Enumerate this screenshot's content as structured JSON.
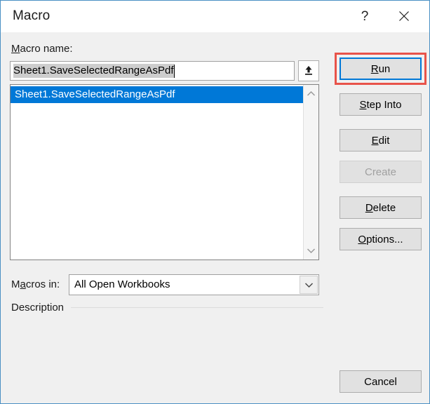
{
  "window": {
    "title": "Macro",
    "help_icon": "question-mark-icon",
    "close_icon": "close-icon"
  },
  "form": {
    "macro_name_label": "Macro name:",
    "macro_name_label_accel": "M",
    "macro_name_value": "Sheet1.SaveSelectedRangeAsPdf",
    "macro_name_placeholder": "",
    "upload_icon": "upload-arrow-icon",
    "macros_in_label": "Macros in:",
    "macros_in_label_accel": "a",
    "macros_in_value": "All Open Workbooks",
    "macros_in_options": [
      "All Open Workbooks"
    ],
    "description_label": "Description",
    "description_value": ""
  },
  "macro_list": {
    "items": [
      {
        "name": "Sheet1.SaveSelectedRangeAsPdf",
        "selected": true
      }
    ],
    "scroll_up_icon": "chevron-up-icon",
    "scroll_down_icon": "chevron-down-icon"
  },
  "buttons": [
    {
      "id": "run",
      "label": "Run",
      "accel": "R",
      "enabled": true,
      "focused": true,
      "annotated": true
    },
    {
      "id": "step_into",
      "label": "Step Into",
      "accel": "S",
      "enabled": true,
      "focused": false,
      "annotated": false
    },
    {
      "id": "edit",
      "label": "Edit",
      "accel": "E",
      "enabled": true,
      "focused": false,
      "annotated": false
    },
    {
      "id": "create",
      "label": "Create",
      "accel": "",
      "enabled": false,
      "focused": false,
      "annotated": false
    },
    {
      "id": "delete",
      "label": "Delete",
      "accel": "D",
      "enabled": true,
      "focused": false,
      "annotated": false
    },
    {
      "id": "options",
      "label": "Options...",
      "accel": "O",
      "enabled": true,
      "focused": false,
      "annotated": false
    },
    {
      "id": "cancel",
      "label": "Cancel",
      "accel": "",
      "enabled": true,
      "focused": false,
      "annotated": false
    }
  ],
  "colors": {
    "selection_blue": "#0078D7",
    "annotation_red": "#E8534A",
    "dialog_border": "#4A90C4",
    "body_background": "#F0F0F0",
    "button_face": "#E1E1E1",
    "disabled_text": "#A0A0A0",
    "inactive_selection": "#CDCDCD"
  }
}
